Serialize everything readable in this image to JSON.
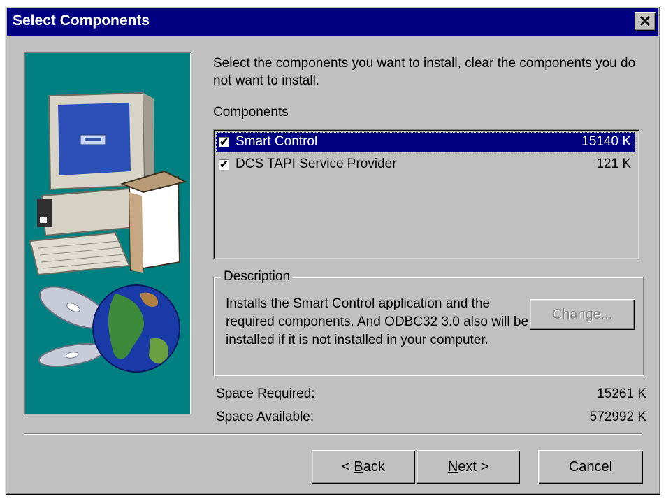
{
  "window": {
    "title": "Select Components",
    "close_symbol": "✕"
  },
  "intro_text": "Select the components you want to install, clear the components you do not want to install.",
  "components_label_accel": "C",
  "components_label_rest": "omponents",
  "components": [
    {
      "name": "Smart Control",
      "size": "15140 K",
      "checked": true,
      "selected": true
    },
    {
      "name": "DCS TAPI Service Provider",
      "size": "121 K",
      "checked": true,
      "selected": false
    }
  ],
  "description": {
    "title": "Description",
    "text": "Installs the Smart Control application and the required components. And ODBC32 3.0 also will be installed if it is not installed in your computer.",
    "change_button": "Change..."
  },
  "space": {
    "required_label": "Space Required:",
    "required_value": "15261 K",
    "available_label": "Space Available:",
    "available_value": "572992 K"
  },
  "buttons": {
    "back_prefix": "< ",
    "back_accel": "B",
    "back_rest": "ack",
    "next_accel": "N",
    "next_rest": "ext >",
    "cancel": "Cancel"
  },
  "check_glyph": "✔",
  "colors": {
    "titlebar": "#000080",
    "face": "#c0c0c0",
    "art_bg": "#008080",
    "selection": "#000080"
  }
}
